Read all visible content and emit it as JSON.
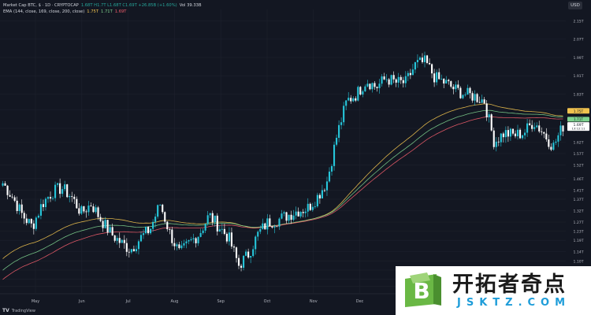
{
  "legend": {
    "symbol": "Market Cap BTC, $ · 1D · CRYPTOCAP",
    "ohlc": "1.68T  H1.7T  L1.68T  C1.69T  +26.85B (+1.60%)",
    "volume": "Vol 39.33B",
    "ema_label": "EMA (144, close, 169, close, 200, close)",
    "ema_v1": "1.75T",
    "ema_v2": "1.71T",
    "ema_v3": "1.69T"
  },
  "currency": "USD",
  "footer_logo_mark": "TV",
  "footer_logo_text": "TradingView",
  "watermark": {
    "cn_text": "开拓者奇点",
    "url_text": "JSKTZ.COM"
  },
  "colors": {
    "background": "#131722",
    "candle_up": "#26c6da",
    "candle_down": "#ffffff",
    "ema_144": "#f0c24e",
    "ema_169": "#7ed38e",
    "ema_200": "#f15d6b",
    "brand_green": "#6ab845",
    "brand_blue": "#1f9dd9"
  },
  "chart_data": {
    "type": "candlestick",
    "title": "Market Cap BTC, $",
    "x": [
      "May",
      "Jun",
      "Jul",
      "Aug",
      "Sep",
      "Oct",
      "Nov",
      "Dec"
    ],
    "y_ticks": [
      "2.15T",
      "2.07T",
      "1.99T",
      "1.91T",
      "1.83T",
      "1.76T",
      "1.68T",
      "1.62T",
      "1.57T",
      "1.52T",
      "1.46T",
      "1.41T",
      "1.37T",
      "1.32T",
      "1.27T",
      "1.23T",
      "1.19T",
      "1.14T",
      "1.10T",
      "1.06T",
      "1.02T",
      "990B"
    ],
    "ylim": [
      0.96,
      2.2
    ],
    "last_price_label": "1.69T",
    "last_price_sub": "13:12:11",
    "ema_label_left": "1.75T",
    "ema_label_right": "1.71T",
    "series": [
      {
        "name": "BTC market cap (T)",
        "weekly_close": [
          1.44,
          1.38,
          1.3,
          1.25,
          1.35,
          1.4,
          1.42,
          1.38,
          1.31,
          1.35,
          1.28,
          1.22,
          1.18,
          1.15,
          1.2,
          1.24,
          1.35,
          1.22,
          1.13,
          1.18,
          1.22,
          1.3,
          1.25,
          1.2,
          1.08,
          1.13,
          1.22,
          1.27,
          1.28,
          1.3,
          1.32,
          1.33,
          1.38,
          1.45,
          1.65,
          1.8,
          1.83,
          1.89,
          1.86,
          1.9,
          1.88,
          1.88,
          1.96,
          1.97,
          1.9,
          1.88,
          1.85,
          1.83,
          1.82,
          1.8,
          1.62,
          1.66,
          1.65,
          1.66,
          1.71,
          1.66,
          1.6,
          1.69
        ]
      },
      {
        "name": "EMA 144",
        "start": 1.1,
        "end": 1.75
      },
      {
        "name": "EMA 169",
        "start": 1.05,
        "end": 1.72
      },
      {
        "name": "EMA 200",
        "start": 1.01,
        "end": 1.69
      }
    ]
  }
}
